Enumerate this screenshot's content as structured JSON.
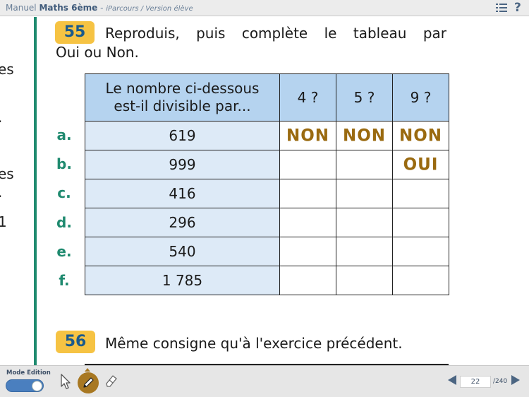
{
  "header": {
    "app_name": "Manuel",
    "book_title": "Maths 6ème",
    "separator": "-",
    "subtitle": "iParcours / Version élève"
  },
  "prev_page_fragment": [
    "es",
    ".",
    "es",
    ".",
    "1"
  ],
  "exercise55": {
    "number": "55",
    "instruction_line1": "Reproduis, puis complète le tableau par",
    "instruction_line2": "Oui ou Non.",
    "table": {
      "header_question_line1": "Le nombre ci-dessous",
      "header_question_line2": "est-il divisible par...",
      "divisors": [
        "4 ?",
        "5 ?",
        "9 ?"
      ],
      "rows": [
        {
          "label": "a.",
          "number": "619",
          "answers": [
            "NON",
            "NON",
            "NON"
          ]
        },
        {
          "label": "b.",
          "number": "999",
          "answers": [
            "",
            "",
            "OUI"
          ]
        },
        {
          "label": "c.",
          "number": "416",
          "answers": [
            "",
            "",
            ""
          ]
        },
        {
          "label": "d.",
          "number": "296",
          "answers": [
            "",
            "",
            ""
          ]
        },
        {
          "label": "e.",
          "number": "540",
          "answers": [
            "",
            "",
            ""
          ]
        },
        {
          "label": "f.",
          "number": "1 785",
          "answers": [
            "",
            "",
            ""
          ]
        }
      ]
    }
  },
  "exercise56": {
    "number": "56",
    "instruction": "Même consigne qu'à l'exercice précédent."
  },
  "toolbar": {
    "mode_label": "Mode Edition",
    "mode_on": true,
    "tools": [
      "cursor-icon",
      "pen-icon",
      "eraser-icon"
    ],
    "active_tool": "pen-icon"
  },
  "pagination": {
    "current_page": "22",
    "total": "/240"
  },
  "colors": {
    "accent_green": "#1f8a6f",
    "badge_yellow": "#f6c343",
    "header_blue": "#b5d3ef",
    "cell_blue": "#ddeaf7",
    "handwriting": "#9a6a10"
  }
}
